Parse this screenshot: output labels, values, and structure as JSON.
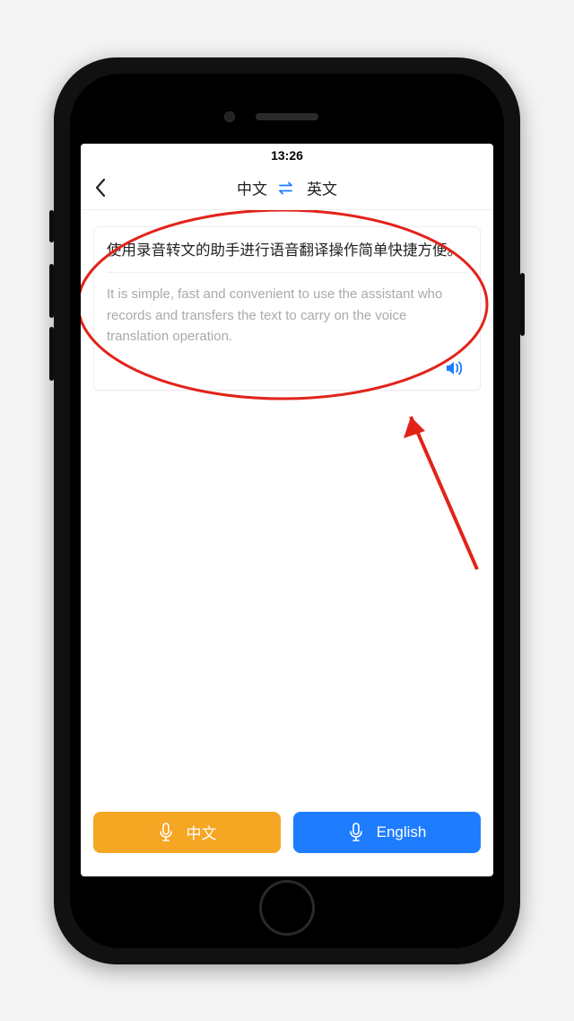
{
  "status": {
    "time": "13:26"
  },
  "nav": {
    "source_lang": "中文",
    "target_lang": "英文"
  },
  "translation": {
    "source": "使用录音转文的助手进行语音翻译操作简单快捷方便。",
    "target": "It is simple, fast and convenient to use the assistant who records and transfers the text to carry on the voice translation operation."
  },
  "footer": {
    "chinese_label": "中文",
    "english_label": "English"
  },
  "colors": {
    "accent_blue": "#1e7dff",
    "accent_orange": "#f5a622",
    "annotation_red": "#e2231a"
  }
}
